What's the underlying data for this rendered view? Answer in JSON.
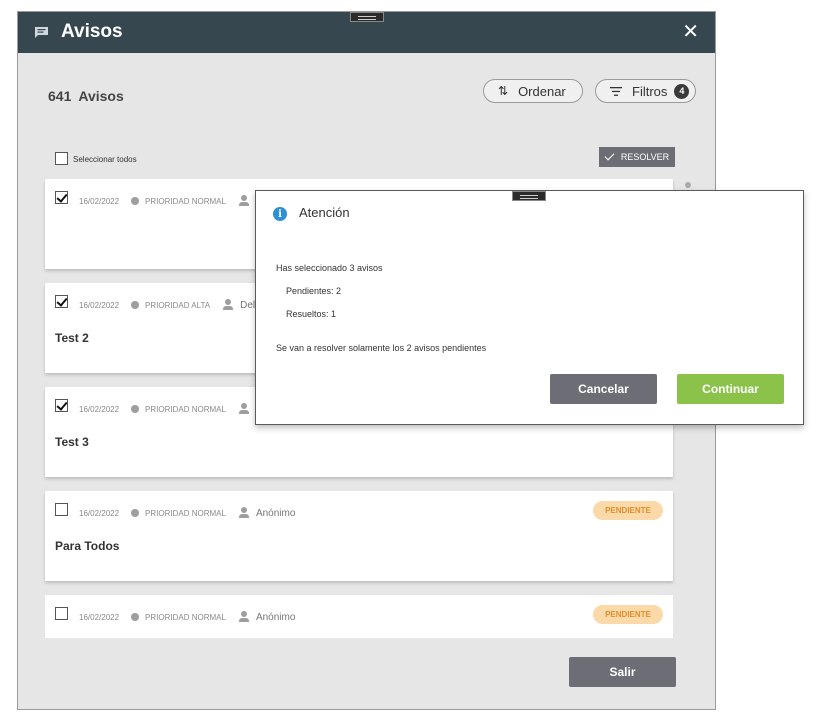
{
  "window": {
    "title": "Avisos",
    "title_icon": "message-icon",
    "close_icon": "close-icon"
  },
  "summary": {
    "count": "641",
    "label": "Avisos"
  },
  "toolbar": {
    "sort_label": "Ordenar",
    "sort_icon": "sort-arrows-icon",
    "filter_label": "Filtros",
    "filter_icon": "filter-icon",
    "filter_count": "4"
  },
  "select_all": {
    "label": "Seleccionar todos",
    "checked": false
  },
  "resolve_button": {
    "label": "RESOLVER"
  },
  "notices": [
    {
      "date": "16/02/2022",
      "priority": "PRIORIDAD NORMAL",
      "author": "",
      "title": "",
      "status": "",
      "checked": true
    },
    {
      "date": "16/02/2022",
      "priority": "PRIORIDAD ALTA",
      "author": "Del",
      "title": "Test 2",
      "status": "",
      "checked": true
    },
    {
      "date": "16/02/2022",
      "priority": "PRIORIDAD NORMAL",
      "author": "",
      "title": "Test 3",
      "status": "",
      "checked": true
    },
    {
      "date": "16/02/2022",
      "priority": "PRIORIDAD NORMAL",
      "author": "Anónimo",
      "title": "Para Todos",
      "status": "PENDIENTE",
      "checked": false
    },
    {
      "date": "16/02/2022",
      "priority": "PRIORIDAD NORMAL",
      "author": "Anónimo",
      "title": "",
      "status": "PENDIENTE",
      "checked": false
    }
  ],
  "exit_button": {
    "label": "Salir"
  },
  "dialog": {
    "title": "Atención",
    "icon": "info-icon",
    "line1": "Has seleccionado 3 avisos",
    "pending": "Pendientes: 2",
    "resolved": "Resueltos: 1",
    "note": "Se van a resolver solamente los 2 avisos pendientes",
    "cancel_label": "Cancelar",
    "continue_label": "Continuar"
  },
  "colors": {
    "titlebar": "#37474f",
    "panel": "#e6e6e6",
    "primary_button": "#6d6d75",
    "continue_button": "#8bc34a",
    "pending_badge_bg": "#fbd9a8",
    "pending_badge_text": "#e0902a",
    "info": "#2d8fd5"
  }
}
